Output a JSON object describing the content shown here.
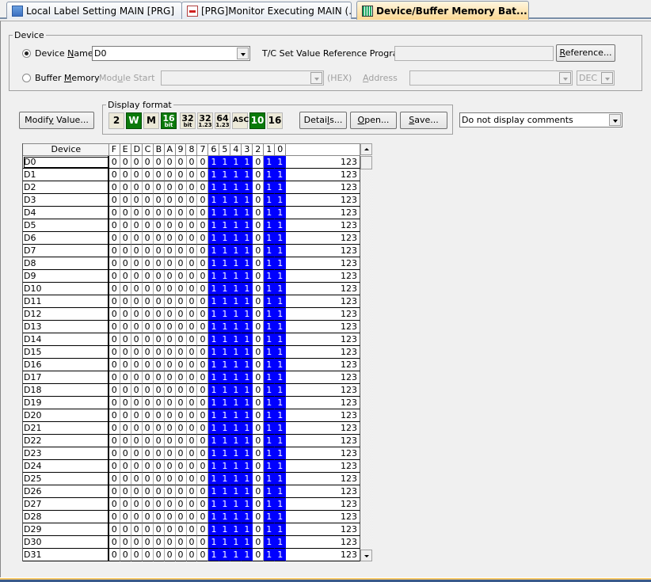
{
  "tabs": [
    {
      "label": "Local Label Setting MAIN [PRG]",
      "icon": "table-icon",
      "active": false
    },
    {
      "label": "[PRG]Monitor Executing MAIN (...",
      "icon": "ladder-monitor-icon",
      "active": false
    },
    {
      "label": "Device/Buffer Memory Bat...",
      "icon": "buffer-memory-icon",
      "active": true
    }
  ],
  "device_group": {
    "legend": "Device",
    "device_name_label": "Device Name",
    "device_name_value": "D0",
    "device_name_selected": true,
    "tc_label": "T/C Set Value Reference Program",
    "tc_value": "",
    "reference_button": "Reference...",
    "buffer_memory_label": "Buffer Memory",
    "buffer_memory_selected": false,
    "module_start_label": "Module Start",
    "module_start_value": "",
    "hex_label": "(HEX)",
    "address_label": "Address",
    "address_value": "",
    "address_base": "DEC"
  },
  "toolbar": {
    "modify_value_button": "Modify Value...",
    "display_format_legend": "Display format",
    "format_buttons": [
      {
        "name": "binary",
        "label": "2",
        "active": false
      },
      {
        "name": "word",
        "label": "W",
        "active": true
      },
      {
        "name": "multi",
        "label": "M",
        "active": false
      },
      {
        "name": "16bit",
        "label": "16",
        "sub": "bit",
        "active": true
      },
      {
        "name": "32bit",
        "label": "32",
        "sub": "bit",
        "active": false
      },
      {
        "name": "32float",
        "label": "32",
        "sub": "1.23",
        "active": false
      },
      {
        "name": "64float",
        "label": "64",
        "sub": "1.23",
        "active": false
      },
      {
        "name": "ascii",
        "label": "ASC",
        "active": false
      },
      {
        "name": "decimal",
        "label": "10",
        "active": true
      },
      {
        "name": "hex",
        "label": "16",
        "active": false
      }
    ],
    "details_button": "Details...",
    "open_button": "Open...",
    "save_button": "Save...",
    "comment_select": "Do not display comments"
  },
  "grid": {
    "headers": {
      "device": "Device",
      "bits": [
        "F",
        "E",
        "D",
        "C",
        "B",
        "A",
        "9",
        "8",
        "7",
        "6",
        "5",
        "4",
        "3",
        "2",
        "1",
        "0"
      ],
      "value": ""
    },
    "rows": [
      {
        "device": "D0",
        "bits": "0000000001111011",
        "value": "123"
      },
      {
        "device": "D1",
        "bits": "0000000001111011",
        "value": "123"
      },
      {
        "device": "D2",
        "bits": "0000000001111011",
        "value": "123"
      },
      {
        "device": "D3",
        "bits": "0000000001111011",
        "value": "123"
      },
      {
        "device": "D4",
        "bits": "0000000001111011",
        "value": "123"
      },
      {
        "device": "D5",
        "bits": "0000000001111011",
        "value": "123"
      },
      {
        "device": "D6",
        "bits": "0000000001111011",
        "value": "123"
      },
      {
        "device": "D7",
        "bits": "0000000001111011",
        "value": "123"
      },
      {
        "device": "D8",
        "bits": "0000000001111011",
        "value": "123"
      },
      {
        "device": "D9",
        "bits": "0000000001111011",
        "value": "123"
      },
      {
        "device": "D10",
        "bits": "0000000001111011",
        "value": "123"
      },
      {
        "device": "D11",
        "bits": "0000000001111011",
        "value": "123"
      },
      {
        "device": "D12",
        "bits": "0000000001111011",
        "value": "123"
      },
      {
        "device": "D13",
        "bits": "0000000001111011",
        "value": "123"
      },
      {
        "device": "D14",
        "bits": "0000000001111011",
        "value": "123"
      },
      {
        "device": "D15",
        "bits": "0000000001111011",
        "value": "123"
      },
      {
        "device": "D16",
        "bits": "0000000001111011",
        "value": "123"
      },
      {
        "device": "D17",
        "bits": "0000000001111011",
        "value": "123"
      },
      {
        "device": "D18",
        "bits": "0000000001111011",
        "value": "123"
      },
      {
        "device": "D19",
        "bits": "0000000001111011",
        "value": "123"
      },
      {
        "device": "D20",
        "bits": "0000000001111011",
        "value": "123"
      },
      {
        "device": "D21",
        "bits": "0000000001111011",
        "value": "123"
      },
      {
        "device": "D22",
        "bits": "0000000001111011",
        "value": "123"
      },
      {
        "device": "D23",
        "bits": "0000000001111011",
        "value": "123"
      },
      {
        "device": "D24",
        "bits": "0000000001111011",
        "value": "123"
      },
      {
        "device": "D25",
        "bits": "0000000001111011",
        "value": "123"
      },
      {
        "device": "D26",
        "bits": "0000000001111011",
        "value": "123"
      },
      {
        "device": "D27",
        "bits": "0000000001111011",
        "value": "123"
      },
      {
        "device": "D28",
        "bits": "0000000001111011",
        "value": "123"
      },
      {
        "device": "D29",
        "bits": "0000000001111011",
        "value": "123"
      },
      {
        "device": "D30",
        "bits": "0000000001111011",
        "value": "123"
      },
      {
        "device": "D31",
        "bits": "0000000001111011",
        "value": "123"
      }
    ],
    "selected_row": 0
  }
}
